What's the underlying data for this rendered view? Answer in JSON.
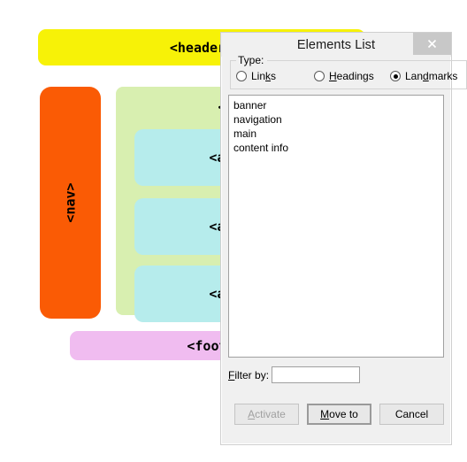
{
  "background_page": {
    "name": "html5-semantic-layout-demo",
    "regions": [
      {
        "label": "<header>",
        "color": "#f7f207"
      },
      {
        "label": "<nav>",
        "color": "#fa5b05"
      },
      {
        "label": "<main>",
        "color": "#d8efb0"
      },
      {
        "label": "<article>",
        "color": "#b6ecec"
      },
      {
        "label": "<article>",
        "color": "#b6ecec"
      },
      {
        "label": "<article>",
        "color": "#b6ecec"
      },
      {
        "label": "<footer>",
        "color": "#f0bcf0"
      }
    ]
  },
  "dialog": {
    "title": "Elements List",
    "close_icon": "close-icon",
    "type_group": {
      "legend": "Type:",
      "options": [
        {
          "label": "Links",
          "accel": "k",
          "selected": false
        },
        {
          "label": "Headings",
          "accel": "H",
          "selected": false
        },
        {
          "label": "Landmarks",
          "accel": "d",
          "selected": true
        }
      ]
    },
    "list": {
      "items": [
        {
          "text": "banner",
          "selected": true
        },
        {
          "text": "navigation",
          "selected": false
        },
        {
          "text": "main",
          "selected": false
        },
        {
          "text": "content info",
          "selected": false
        }
      ]
    },
    "filter": {
      "label": "Filter by:",
      "accel": "F",
      "value": "",
      "placeholder": ""
    },
    "buttons": [
      {
        "label": "Activate",
        "accel": "A",
        "disabled": true,
        "default": false
      },
      {
        "label": "Move to",
        "accel": "M",
        "disabled": false,
        "default": true
      },
      {
        "label": "Cancel",
        "accel": "",
        "disabled": false,
        "default": false
      }
    ]
  },
  "colors": {
    "header": "#f7f207",
    "nav": "#fa5b05",
    "main": "#d8efb0",
    "article": "#b6ecec",
    "footer": "#f0bcf0",
    "dialog_bg": "#f0f0f0",
    "close_btn": "#c8c8c8"
  }
}
